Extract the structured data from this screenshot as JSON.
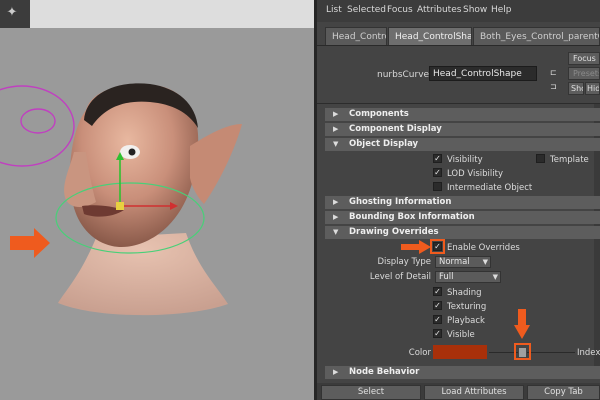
{
  "menubar": [
    "List",
    "Selected",
    "Focus",
    "Attributes",
    "Show",
    "Help"
  ],
  "tabs": [
    "Head_Control",
    "Head_ControlShape",
    "Both_Eyes_Control_parentConstr"
  ],
  "node": {
    "type_label": "nurbsCurve:",
    "name": "Head_ControlShape"
  },
  "header_buttons": {
    "focus": "Focus",
    "presets": "Presets",
    "show": "Show",
    "hide": "Hide"
  },
  "sections": {
    "components": "Components",
    "component_display": "Component Display",
    "object_display": "Object Display",
    "ghosting": "Ghosting Information",
    "bounding_box": "Bounding Box Information",
    "drawing_overrides": "Drawing Overrides",
    "node_behavior": "Node Behavior"
  },
  "object_display": {
    "visibility": {
      "label": "Visibility",
      "checked": true
    },
    "template": {
      "label": "Template",
      "checked": false
    },
    "lod_visibility": {
      "label": "LOD Visibility",
      "checked": true
    },
    "intermediate_object": {
      "label": "Intermediate Object",
      "checked": false
    }
  },
  "drawing_overrides": {
    "enable_overrides": {
      "label": "Enable Overrides",
      "checked": true
    },
    "display_type": {
      "label": "Display Type",
      "value": "Normal"
    },
    "level_of_detail": {
      "label": "Level of Detail",
      "value": "Full"
    },
    "shading": {
      "label": "Shading",
      "checked": true
    },
    "texturing": {
      "label": "Texturing",
      "checked": true
    },
    "playback": {
      "label": "Playback",
      "checked": true
    },
    "visible": {
      "label": "Visible",
      "checked": true
    },
    "color": {
      "label": "Color",
      "swatch": "#a8300a",
      "suffix": "Index",
      "slider_fraction": 0.4
    }
  },
  "bottom_buttons": {
    "select": "Select",
    "load_attributes": "Load Attributes",
    "copy_tab": "Copy Tab"
  },
  "colors": {
    "annotation_orange": "#ef5b1e",
    "curve_magenta": "#c040c0",
    "curve_green": "#48d078"
  },
  "icons": [
    "maya-logo-icon",
    "triangle-right-icon",
    "triangle-down-icon",
    "check-icon",
    "chevron-down-icon",
    "arrow-right-icon",
    "arrow-down-icon"
  ]
}
